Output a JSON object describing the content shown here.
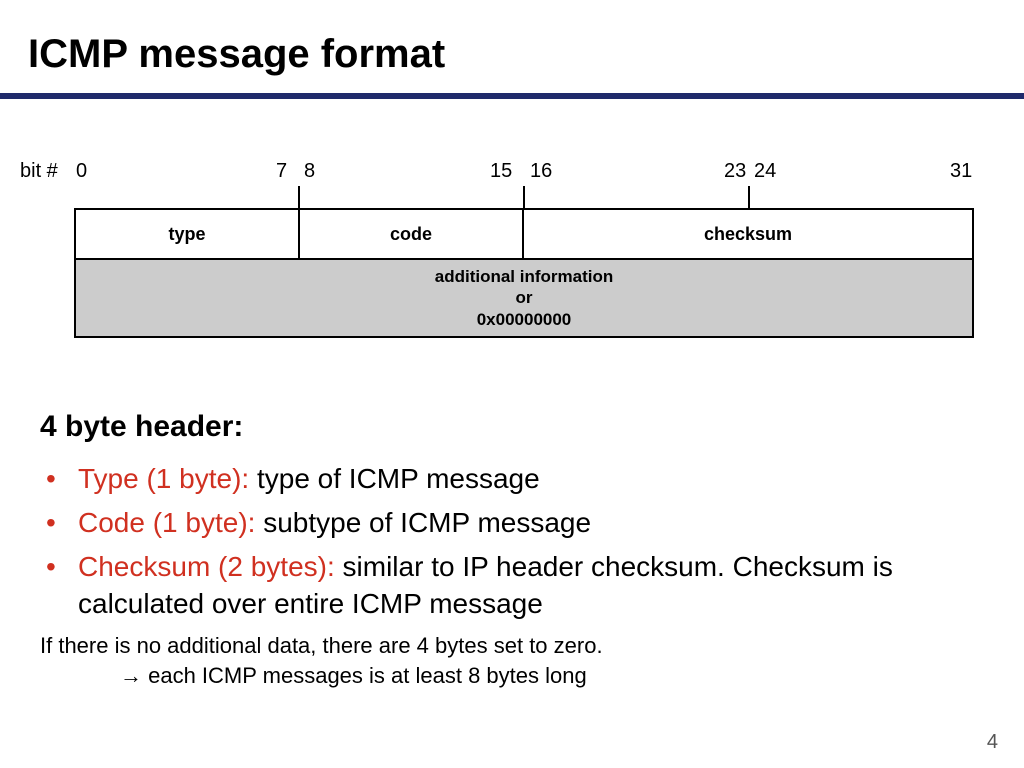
{
  "title": "ICMP message format",
  "diagram": {
    "bit_hash": "bit #",
    "bits": [
      "0",
      "7",
      "8",
      "15",
      "16",
      "23",
      "24",
      "31"
    ],
    "row1": {
      "type": "type",
      "code": "code",
      "checksum": "checksum"
    },
    "row2": {
      "line1": "additional information",
      "line2": "or",
      "line3": "0x00000000"
    }
  },
  "heading": "4 byte header:",
  "bullets": [
    {
      "term": "Type (1 byte): ",
      "desc": "type of ICMP message"
    },
    {
      "term": "Code (1 byte): ",
      "desc": "subtype of ICMP message"
    },
    {
      "term": "Checksum (2 bytes): ",
      "desc": "similar to IP header checksum. Checksum is calculated over entire ICMP message"
    }
  ],
  "note_line1": "If there is no additional data, there are 4 bytes set to zero.",
  "note_line2": "→ each ICMP messages is at least 8 bytes long",
  "page_number": "4"
}
